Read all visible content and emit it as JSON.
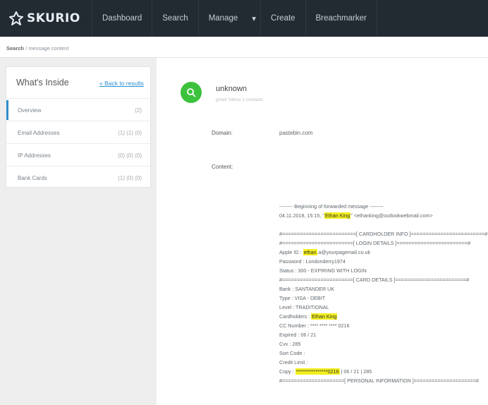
{
  "brand": {
    "name": "SKURIO"
  },
  "nav": {
    "items": [
      "Dashboard",
      "Search",
      "Manage",
      "Create",
      "Breachmarker"
    ],
    "caret": "▾"
  },
  "breadcrumb": {
    "first": "Search",
    "rest": " / message content"
  },
  "sidebar": {
    "title": "What's Inside",
    "back_link": "« Back to results",
    "items": [
      {
        "label": "Overview",
        "count": "(2)"
      },
      {
        "label": "Email Addresses",
        "count": "(1) (1) (0)"
      },
      {
        "label": "IP Addresses",
        "count": "(0) (0) (0)"
      },
      {
        "label": "Bank Cards",
        "count": "(1) (0) (0)"
      }
    ]
  },
  "message": {
    "sender": "unknown",
    "sender_sub": "gmail Yahoo 1 contacts",
    "domain_label": "Domain:",
    "domain_value": "pastebin.com",
    "content_label": "Content:",
    "lines": [
      {
        "pre": "-------- Beginning of forwarded message --------"
      },
      {
        "pre": "04.11.2018, 15:15, \"",
        "hl": "Ethan King",
        "post": "\" <ethanking@outlookwebmail.com>"
      },
      {
        "pre": ""
      },
      {
        "pre": "#=========================[ CARDHOLDER INFO ]=========================#"
      },
      {
        "pre": "#========================[ LOGIN DETAILS ]========================#"
      },
      {
        "pre": "Apple ID : ",
        "hl": "ethan",
        "post": ".a@yourpagemail.co.uk"
      },
      {
        "pre": "Password : Londonderry1974"
      },
      {
        "pre": "Status : 300 - EXPIRING WITH LOGIN"
      },
      {
        "pre": "#========================[ CARD DETAILS ]========================#"
      },
      {
        "pre": "Bank : SANTANDER UK"
      },
      {
        "pre": "Type : VISA - DEBIT"
      },
      {
        "pre": "Level : TRADITIONAL"
      },
      {
        "pre": "Cardholders : ",
        "hl": "Ethan King"
      },
      {
        "pre": "CC Number : **** **** **** 0216"
      },
      {
        "pre": "Expired : 06 / 21"
      },
      {
        "pre": "Cvv : 285"
      },
      {
        "pre": "Sort Code : "
      },
      {
        "pre": "Credit Limit : "
      },
      {
        "pre": "Copy : ",
        "hl": "****************0216",
        "post": " | 06 / 21 | 285"
      },
      {
        "pre": "#=====================[ PERSONAL INFORMATION ]=====================#"
      }
    ]
  },
  "colors": {
    "topbar": "#222a32",
    "accent": "#2b8fcf",
    "avatar": "#3cc23c",
    "highlight": "#f3ef1f"
  }
}
